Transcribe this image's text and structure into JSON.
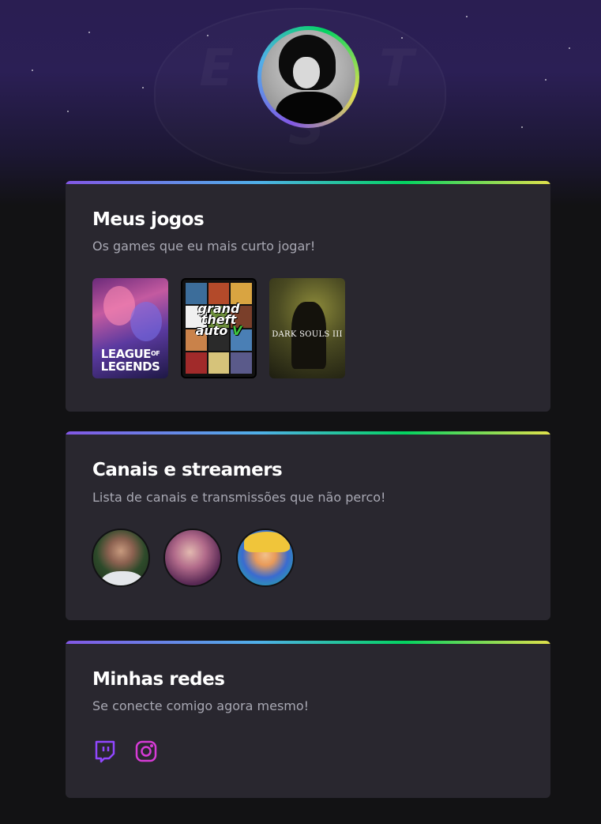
{
  "profile": {
    "avatar_icon": "profile-avatar-icon",
    "accent_gradient": [
      "#8257e5",
      "#4fb0e8",
      "#04d361",
      "#e1e14c"
    ]
  },
  "games_card": {
    "title": "Meus jogos",
    "subtitle": "Os games que eu mais curto jogar!",
    "games": [
      {
        "cover_text": [
          "LEAGUE",
          "LEGENDS"
        ],
        "cover_small": "OF"
      },
      {
        "cover_text": [
          "grand",
          "theft",
          "auto"
        ],
        "cover_small": "V"
      },
      {
        "cover_text": [
          "DARK SOULS III"
        ]
      }
    ]
  },
  "streamers_card": {
    "title": "Canais e streamers",
    "subtitle": "Lista de canais e transmissões que não perco!",
    "streamers_icon": "streamer-avatar-icon"
  },
  "social_card": {
    "title": "Minhas redes",
    "subtitle": "Se conecte comigo agora mesmo!",
    "links": [
      {
        "icon": "twitch-icon",
        "color": "#9147ff"
      },
      {
        "icon": "instagram-icon",
        "color": "#e1306c"
      }
    ]
  },
  "colors": {
    "background": "#121214",
    "card": "#29272f",
    "subtitle_text": "#a8a8b3",
    "hero_purple": "#2b1f55"
  }
}
